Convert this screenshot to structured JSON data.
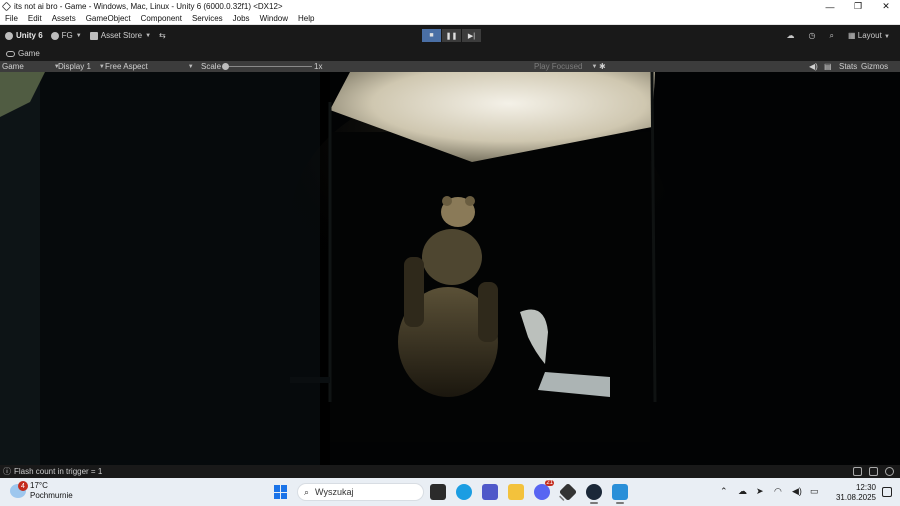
{
  "window": {
    "title": "its not ai bro - Game - Windows, Mac, Linux - Unity 6 (6000.0.32f1) <DX12>",
    "controls": [
      "—",
      "❐",
      "✕"
    ]
  },
  "menu": [
    "File",
    "Edit",
    "Assets",
    "GameObject",
    "Component",
    "Services",
    "Jobs",
    "Window",
    "Help"
  ],
  "toolbar": {
    "unity_label": "Unity 6",
    "account_label": "FG",
    "asset_store_label": "Asset Store",
    "play_state": "playing",
    "layout_label": "Layout"
  },
  "tab": {
    "label": "Game"
  },
  "game_view_bar": {
    "mode": "Game",
    "display": "Display 1",
    "aspect": "Free Aspect",
    "scale_label": "Scale",
    "scale_value": "1x",
    "play_focused": "Play Focused",
    "stats": "Stats",
    "gizmos": "Gizmos"
  },
  "status": {
    "message": "Flash count in trigger = 1"
  },
  "taskbar": {
    "weather_temp": "17°C",
    "weather_desc": "Pochmurnie",
    "weather_badge": "4",
    "search_placeholder": "Wyszukaj",
    "time": "12:30",
    "date": "31.08.2025",
    "apps": [
      {
        "name": "file-manager-app",
        "color": "#2b2b2b"
      },
      {
        "name": "edge-browser-app",
        "color": "#1b9de2"
      },
      {
        "name": "teams-app",
        "color": "#5059c9"
      },
      {
        "name": "file-explorer-app",
        "color": "#f3c23c"
      },
      {
        "name": "discord-app",
        "color": "#5865f2"
      },
      {
        "name": "unity-hub-app",
        "color": "#333333"
      },
      {
        "name": "steam-app",
        "color": "#1b2838"
      },
      {
        "name": "photos-app",
        "color": "#2a8fd8"
      }
    ],
    "discord_badge": "21"
  },
  "icons": {
    "accent": "#4a6fa5",
    "editor_bg": "#191919",
    "bar_bg": "#3c3c3c"
  }
}
